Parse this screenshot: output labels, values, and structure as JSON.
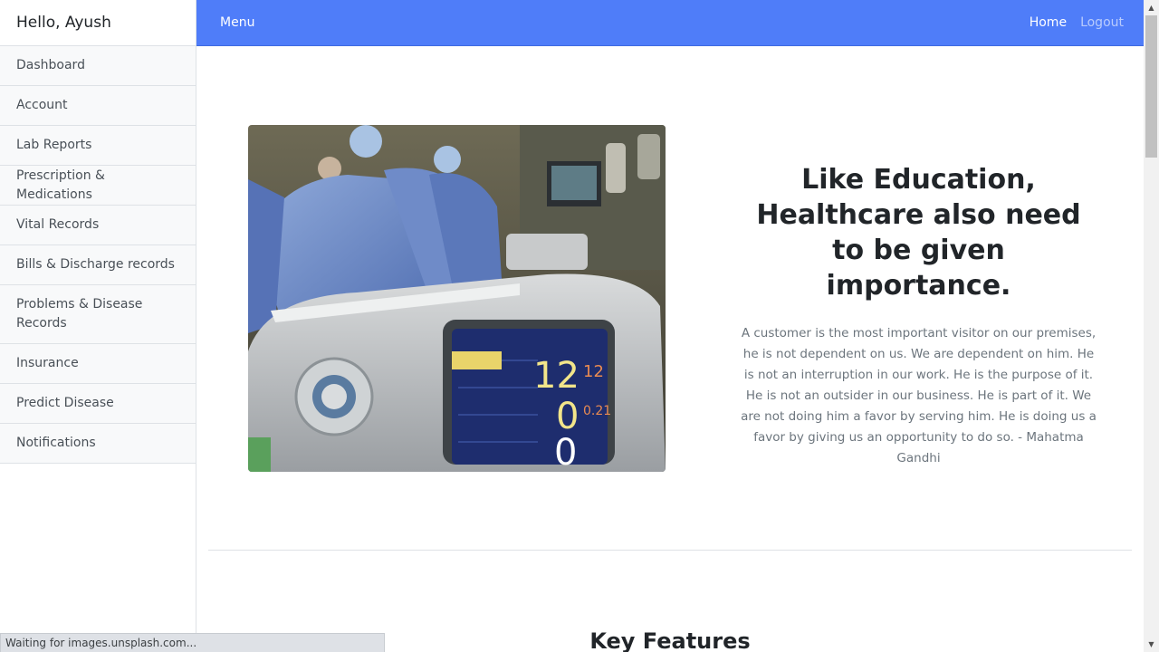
{
  "sidebar": {
    "greeting": "Hello, Ayush",
    "items": [
      {
        "label": "Dashboard"
      },
      {
        "label": "Account"
      },
      {
        "label": "Lab Reports"
      },
      {
        "label": "Prescription & Medications"
      },
      {
        "label": "Vital Records"
      },
      {
        "label": "Bills & Discharge records"
      },
      {
        "label": "Problems & Disease Records"
      },
      {
        "label": "Insurance"
      },
      {
        "label": "Predict Disease"
      },
      {
        "label": "Notifications"
      }
    ]
  },
  "navbar": {
    "menu_label": "Menu",
    "home_label": "Home",
    "logout_label": "Logout",
    "background": "#4f7df9"
  },
  "hero": {
    "title": "Like Education, Healthcare also need to be given importance.",
    "quote": "A customer is the most important visitor on our premises, he is not dependent on us. We are dependent on him. He is not an interruption in our work. He is the purpose of it. He is not an outsider in our business. He is part of it. We are not doing him a favor by serving him. He is doing us a favor by giving us an opportunity to do so. - Mahatma Gandhi"
  },
  "section": {
    "heading": "Key Features"
  },
  "status_bar": {
    "text": "Waiting for images.unsplash.com..."
  }
}
